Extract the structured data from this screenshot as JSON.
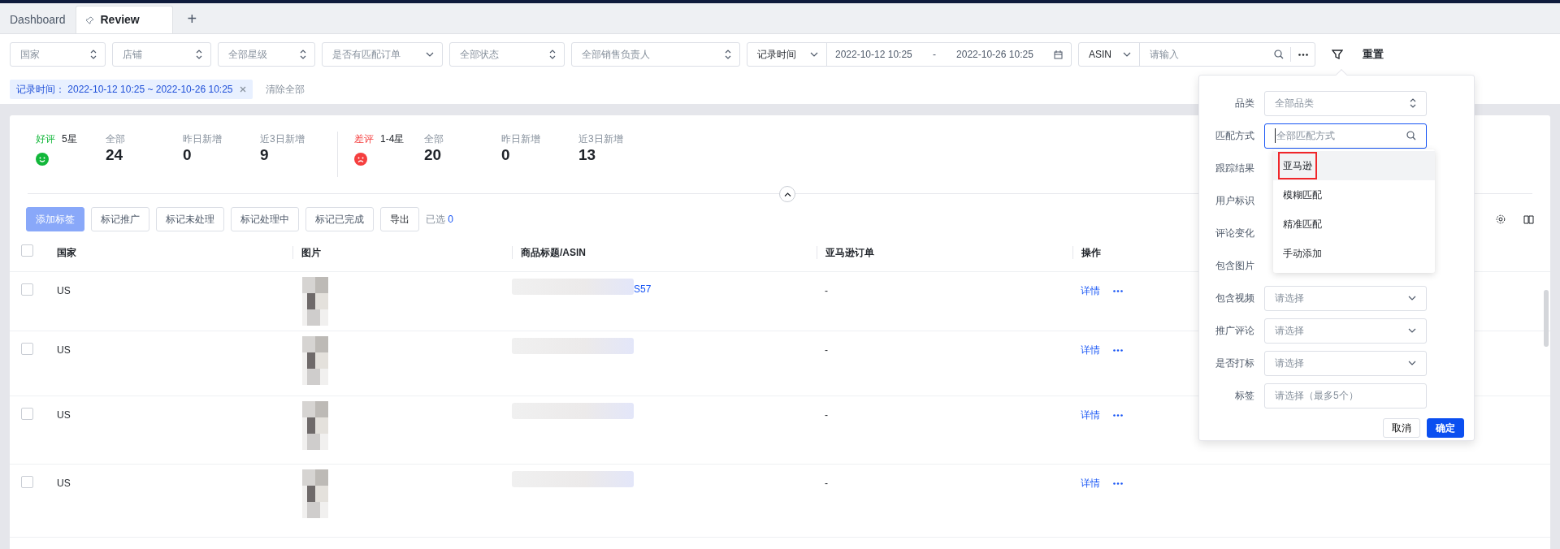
{
  "tabs": [
    {
      "label": "Dashboard",
      "selected": false,
      "pinned": false
    },
    {
      "label": "Review",
      "selected": true,
      "pinned": true
    }
  ],
  "add_tab": "+",
  "filters": [
    {
      "kind": "updown",
      "placeholder": "国家"
    },
    {
      "kind": "updown",
      "placeholder": "店铺"
    },
    {
      "kind": "updown",
      "placeholder": "全部星级"
    },
    {
      "kind": "down",
      "placeholder": "是否有匹配订单"
    },
    {
      "kind": "updown",
      "placeholder": "全部状态"
    },
    {
      "kind": "updown",
      "placeholder": "全部销售负责人"
    }
  ],
  "time_filter": {
    "field": "记录时间",
    "start": "2022-10-12 10:25",
    "separator": "-",
    "end": "2022-10-26 10:25"
  },
  "search": {
    "field": "ASIN",
    "placeholder": "请输入"
  },
  "reset": "重置",
  "active_filters": [
    {
      "label": "记录时间：",
      "value": "2022-10-12 10:25 ~ 2022-10-26 10:25"
    }
  ],
  "clear_all": "清除全部",
  "stats": [
    {
      "kind": "good",
      "title": "好评",
      "subtitle": "5星",
      "metrics": [
        {
          "label": "全部",
          "value": "24"
        },
        {
          "label": "昨日新增",
          "value": "0"
        },
        {
          "label": "近3日新增",
          "value": "9"
        }
      ]
    },
    {
      "kind": "bad",
      "title": "差评",
      "subtitle": "1-4星",
      "metrics": [
        {
          "label": "全部",
          "value": "20"
        },
        {
          "label": "昨日新增",
          "value": "0"
        },
        {
          "label": "近3日新增",
          "value": "13"
        }
      ]
    }
  ],
  "actions": [
    {
      "label": "添加标签",
      "primary": true,
      "disabled": true
    },
    {
      "label": "标记推广",
      "primary": false,
      "disabled": false
    },
    {
      "label": "标记未处理",
      "primary": false,
      "disabled": false
    },
    {
      "label": "标记处理中",
      "primary": false,
      "disabled": false
    },
    {
      "label": "标记已完成",
      "primary": false,
      "disabled": false
    },
    {
      "label": "导出",
      "primary": false,
      "disabled": false
    }
  ],
  "selected_count": {
    "label": "已选",
    "value": "0"
  },
  "table": {
    "all_checked": false,
    "columns": [
      "国家",
      "图片",
      "商品标题/ASIN",
      "亚马逊订单",
      "操作"
    ],
    "rows": [
      {
        "checked": false,
        "country": "US",
        "asin": "S57",
        "order": "-",
        "link": "详情"
      },
      {
        "checked": false,
        "country": "US",
        "order": "-",
        "link": "详情"
      },
      {
        "checked": false,
        "country": "US",
        "order": "-",
        "link": "详情"
      },
      {
        "checked": false,
        "country": "US",
        "order": "-",
        "link": "详情"
      }
    ]
  },
  "filter_panel": {
    "fields": [
      {
        "label": "品类",
        "kind": "updown",
        "placeholder": "全部品类"
      },
      {
        "label": "匹配方式",
        "kind": "search",
        "placeholder": "全部匹配方式",
        "focused": true,
        "options": [
          {
            "label": "亚马逊",
            "hovered": true,
            "annotated": true
          },
          {
            "label": "模糊匹配",
            "hovered": false,
            "annotated": false
          },
          {
            "label": "精准匹配",
            "hovered": false,
            "annotated": false
          },
          {
            "label": "手动添加",
            "hovered": false,
            "annotated": false
          }
        ]
      },
      {
        "label": "跟踪结果",
        "kind": "covered"
      },
      {
        "label": "用户标识",
        "kind": "covered"
      },
      {
        "label": "评论变化",
        "kind": "covered"
      },
      {
        "label": "包含图片",
        "kind": "covered"
      },
      {
        "label": "包含视频",
        "kind": "down",
        "placeholder": "请选择"
      },
      {
        "label": "推广评论",
        "kind": "down",
        "placeholder": "请选择"
      },
      {
        "label": "是否打标",
        "kind": "down",
        "placeholder": "请选择"
      },
      {
        "label": "标签",
        "kind": "plain",
        "placeholder": "请选择（最多5个）"
      }
    ],
    "buttons": [
      {
        "label": "取消",
        "primary": false
      },
      {
        "label": "确定",
        "primary": true
      }
    ]
  }
}
